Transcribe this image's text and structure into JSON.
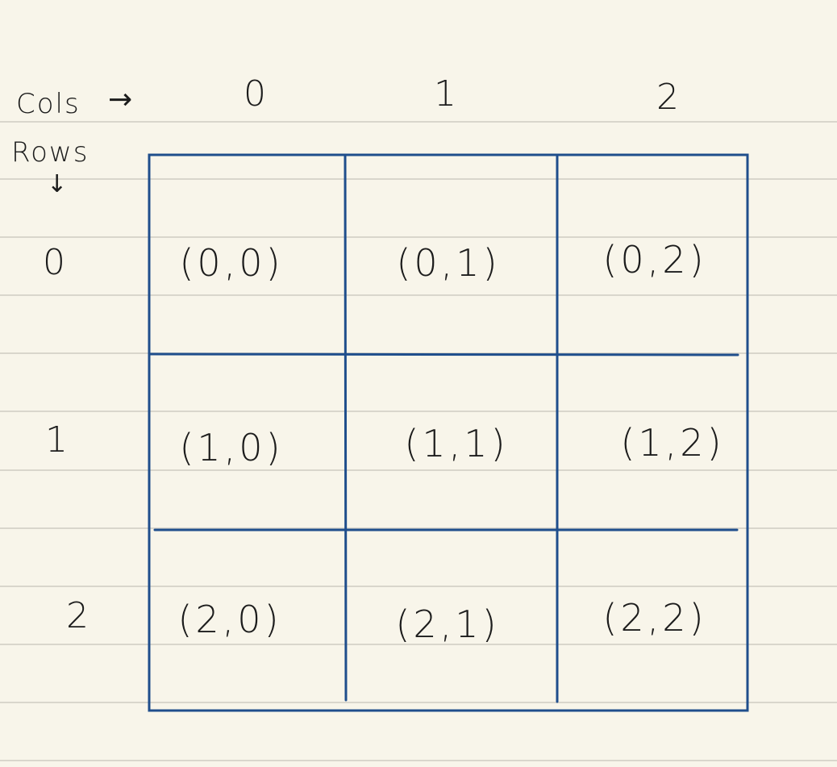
{
  "header": {
    "cols_label": "Cols",
    "rows_label": "Rows",
    "cols_arrow": "→",
    "rows_arrow": "↓"
  },
  "columns": [
    "0",
    "1",
    "2"
  ],
  "rows": [
    "0",
    "1",
    "2"
  ],
  "cells": [
    [
      "(0,0)",
      "(0,1)",
      "(0,2)"
    ],
    [
      "(1,0)",
      "(1,1)",
      "(1,2)"
    ],
    [
      "(2,0)",
      "(2,1)",
      "(2,2)"
    ]
  ],
  "colors": {
    "paper": "#f8f5ea",
    "rule_lines": "#d9d6cc",
    "grid": "#1f4e8c",
    "ink": "#1c1c1c"
  }
}
